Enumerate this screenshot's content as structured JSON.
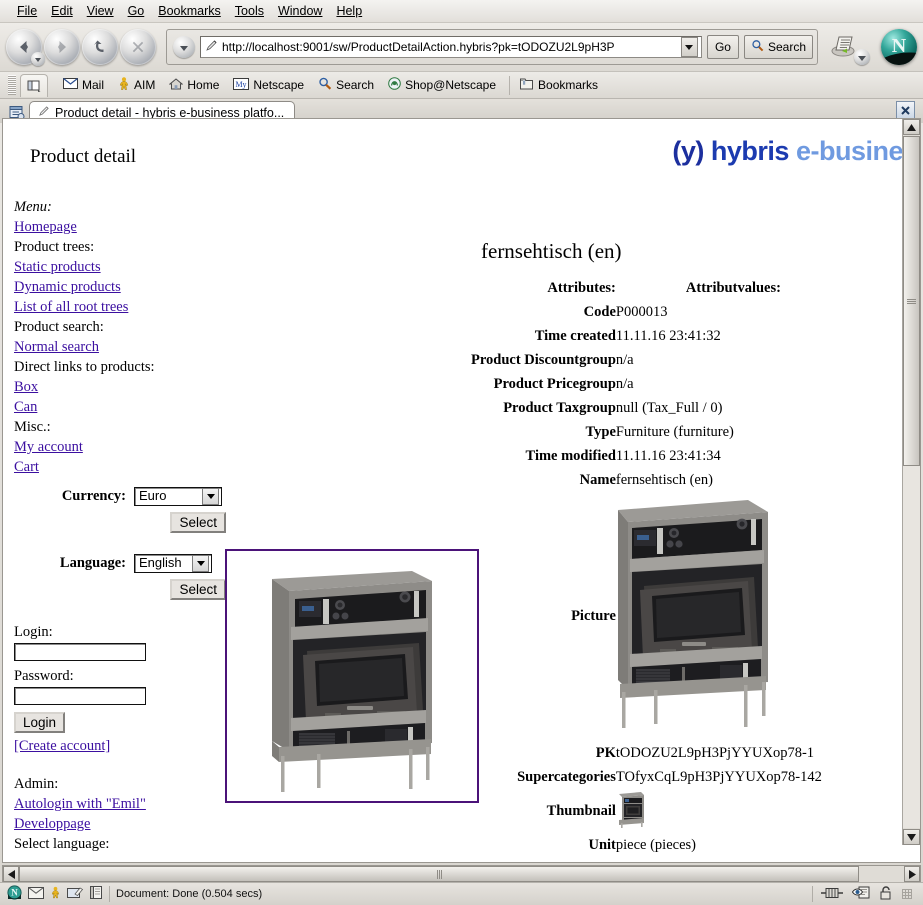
{
  "browser": {
    "menus": [
      "File",
      "Edit",
      "View",
      "Go",
      "Bookmarks",
      "Tools",
      "Window",
      "Help"
    ],
    "url": "http://localhost:9001/sw/ProductDetailAction.hybris?pk=tODOZU2L9pH3P",
    "go_label": "Go",
    "search_label": "Search",
    "personal_toolbar": [
      {
        "label": "Mail",
        "icon": "mail-icon"
      },
      {
        "label": "AIM",
        "icon": "aim-person-icon"
      },
      {
        "label": "Home",
        "icon": "home-icon"
      },
      {
        "label": "Netscape",
        "icon": "my-netscape-icon"
      },
      {
        "label": "Search",
        "icon": "search-magnifier-icon"
      },
      {
        "label": "Shop@Netscape",
        "icon": "shop-icon"
      },
      {
        "label": "Bookmarks",
        "icon": "bookmarks-folder-icon"
      }
    ],
    "tab_title": "Product detail - hybris e-business platfo...",
    "status_text": "Document: Done (0.504 secs)"
  },
  "page": {
    "title": "Product detail",
    "logo": {
      "mark": "(y)",
      "brand": "hybris",
      "tagline": "e-busine"
    },
    "sidebar": {
      "menu_heading": "Menu:",
      "homepage_link": "Homepage",
      "product_trees_heading": "Product trees:",
      "static_products_link": "Static products",
      "dynamic_products_link": "Dynamic products",
      "root_trees_link": "List of all root trees",
      "product_search_heading": "Product search:",
      "normal_search_link": "Normal search",
      "direct_links_heading": "Direct links to products:",
      "box_link": "Box",
      "can_link": "Can",
      "misc_heading": "Misc.:",
      "my_account_link": "My account",
      "cart_link": "Cart",
      "currency_label": "Currency:",
      "currency_value": "Euro",
      "currency_select_button": "Select",
      "language_label": "Language:",
      "language_value": "English",
      "language_select_button": "Select",
      "login_label": "Login:",
      "login_value": "",
      "password_label": "Password:",
      "password_value": "",
      "login_button": "Login",
      "create_account_link": "[Create account]",
      "admin_heading": "Admin:",
      "autologin_link": "Autologin with \"Emil\"",
      "developpage_link": "Developpage",
      "select_language_heading": "Select language:"
    },
    "product": {
      "heading": "fernsehtisch (en)",
      "col_attributes": "Attributes:",
      "col_values": "Attributvalues:",
      "rows": [
        {
          "key": "Code",
          "value": "P000013"
        },
        {
          "key": "Time created",
          "value": "11.11.16 23:41:32"
        },
        {
          "key": "Product Discountgroup",
          "value": "n/a"
        },
        {
          "key": "Product Pricegroup",
          "value": "n/a"
        },
        {
          "key": "Product Taxgroup",
          "value": "null (Tax_Full / 0)"
        },
        {
          "key": "Type",
          "value": "Furniture (furniture)"
        },
        {
          "key": "Time modified",
          "value": "11.11.16 23:41:34"
        },
        {
          "key": "Name",
          "value": "fernsehtisch (en)"
        }
      ],
      "picture_label": "Picture",
      "pk_label": "PK",
      "pk_value": "tODOZU2L9pH3PjYYUXop78-1",
      "supercategories_label": "Supercategories",
      "supercategories_value": "TOfyxCqL9pH3PjYYUXop78-142",
      "thumbnail_label": "Thumbnail",
      "unit_label": "Unit",
      "unit_value": "piece (pieces)"
    }
  },
  "colors": {
    "link": "#3b0fa0",
    "image_border": "#4b1379",
    "brand_dark": "#1c3bb0",
    "brand_light": "#6f9ae0"
  }
}
